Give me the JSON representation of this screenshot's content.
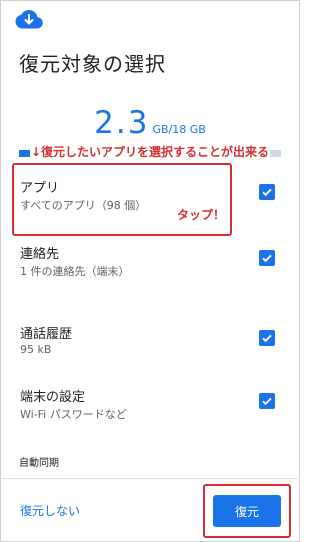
{
  "title": "復元対象の選択",
  "storage": {
    "used": "2.3",
    "total_text": "GB/18 GB",
    "fraction": 0.128
  },
  "annotation": "↓復元したいアプリを選択することが出来る",
  "items": [
    {
      "label": "アプリ",
      "sub": "すべてのアプリ（98 個）",
      "checked": true
    },
    {
      "label": "連絡先",
      "sub": "1 件の連絡先（端末）",
      "checked": true
    },
    {
      "label": "通話履歴",
      "sub": "95 kB",
      "checked": true
    },
    {
      "label": "端末の設定",
      "sub": "Wi-Fi パスワードなど",
      "checked": true
    }
  ],
  "tap_label": "タップ！",
  "section_auto_sync": "自動同期",
  "skip_label": "復元しない",
  "restore_label": "復元",
  "colors": {
    "accent": "#1a73e8",
    "annotation": "#d32f2f"
  },
  "icons": {
    "header": "cloud-download-icon",
    "check": "checkbox-checked-icon"
  }
}
